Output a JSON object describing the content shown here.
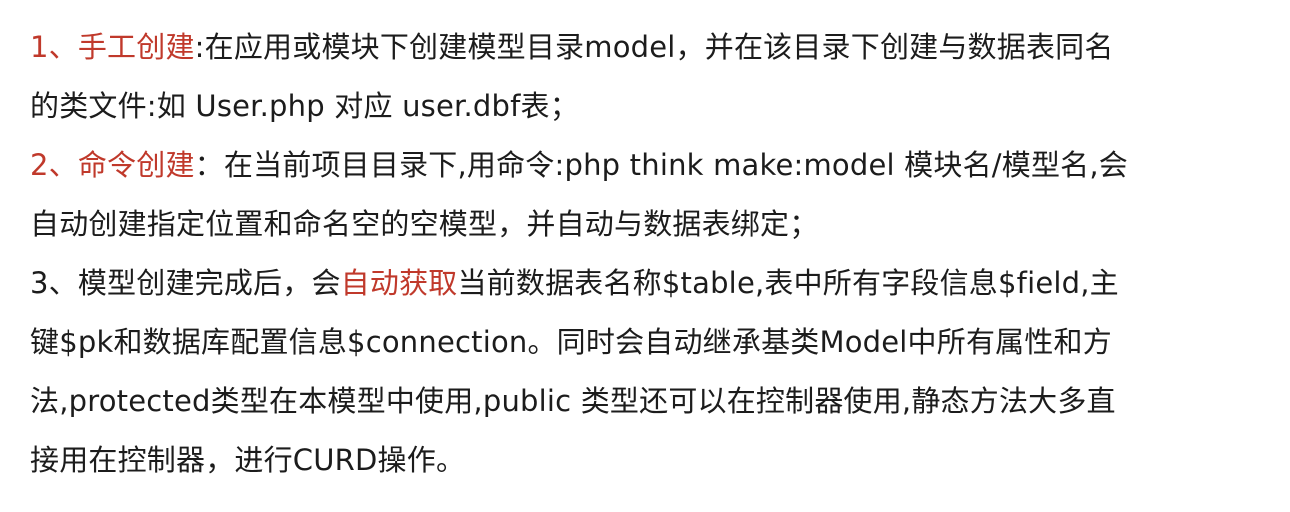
{
  "accent_color": "#c0392b",
  "text_color": "#1c1c1c",
  "items": [
    {
      "number": "1、",
      "title": "手工创建",
      "line1": ":在应用或模块下创建模型目录model，并在该目录下创建与数据表同名",
      "line2": "的类文件:如 User.php 对应 user.dbf表；"
    },
    {
      "number": "2、",
      "title": "命令创建",
      "line1": "：在当前项目目录下,用命令:php think make:model 模块名/模型名,会",
      "line2": "自动创建指定位置和命名空的空模型，并自动与数据表绑定；"
    },
    {
      "number": "3、",
      "line1_before": "模型创建完成后，会",
      "line1_highlight": "自动获取",
      "line1_after": "当前数据表名称$table,表中所有字段信息$field,主",
      "line2": "键$pk和数据库配置信息$connection。同时会自动继承基类Model中所有属性和方",
      "line3": "法,protected类型在本模型中使用,public 类型还可以在控制器使用,静态方法大多直",
      "line4": "接用在控制器，进行CURD操作。"
    }
  ]
}
